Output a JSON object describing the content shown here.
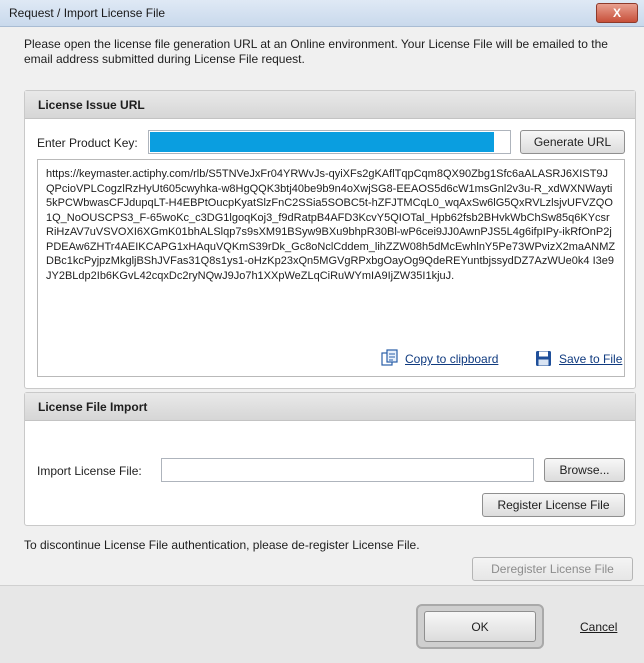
{
  "window": {
    "title": "Request / Import License File",
    "close_label": "X"
  },
  "intro": "Please open the license file generation URL at an Online environment. Your License File will be emailed to the email address submitted during License File request.",
  "issue_section": {
    "header": "License Issue URL",
    "product_key_label": "Enter Product Key:",
    "generate_button": "Generate URL",
    "url_text": "https://keymaster.actiphy.com/rlb/S5TNVeJxFr04YRWvJs-qyiXFs2gKAflTqpCqm8QX90Zbg1Sfc6aALASRJ6XIST9JQPcioVPLCogzlRzHyUt605cwyhka-w8HgQQK3btj40be9b9n4oXwjSG8-EEAOS5d6cW1msGnl2v3u-R_xdWXNWayti5kPCWbwasCFJdupqLT-H4EBPtOucpKyatSlzFnC2SSia5SOBC5t-hZFJTMCqL0_wqAxSw6lG5QxRVLzlsjvUFVZQO1Q_NoOUSCPS3_F-65woKc_c3DG1lgoqKoj3_f9dRatpB4AFD3KcvY5QIOTal_Hpb62fsb2BHvkWbChSw85q6KYcsrRiHzAV7uVSVOXI6XGmK01bhALSlqp7s9sXM91BSyw9BXu9bhpR30Bl-wP6cei9JJ0AwnPJS5L4g6ifpIPy-ikRfOnP2jPDEAw6ZHTr4AEIKCAPG1xHAquVQKmS39rDk_Gc8oNclCddem_lihZZW08h5dMcEwhlnY5Pe73WPvizX2maANMZDBc1kcPyjpzMkgljBShJVFas31Q8s1ys1-oHzKp23xQn5MGVgRPxbgOayOg9QdeREYuntbjssydDZ7AzWUe0k4 I3e9JY2BLdp2Ib6KGvL42cqxDc2ryNQwJ9Jo7h1XXpWeZLqCiRuWYmIA9IjZW35I1kjuJ.",
    "copy_link": "Copy to clipboard",
    "save_link": "Save to File",
    "accent_color": "#0a9ee0"
  },
  "import_section": {
    "header": "License File Import",
    "import_label": "Import License File:",
    "import_value": "",
    "browse_button": "Browse...",
    "register_button": "Register License File"
  },
  "deregister_note": "To discontinue License File authentication, please de-register License File.",
  "deregister_button": "Deregister License File",
  "ok_button": "OK",
  "cancel_link": "Cancel"
}
